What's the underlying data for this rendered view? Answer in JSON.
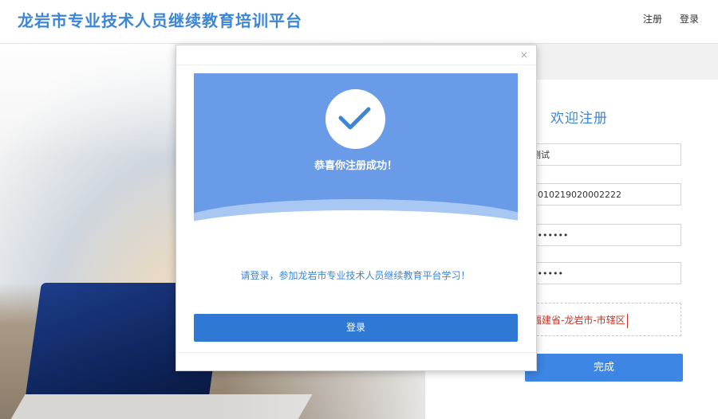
{
  "header": {
    "title": "龙岩市专业技术人员继续教育培训平台"
  },
  "nav": {
    "register": "注册",
    "login": "登录"
  },
  "register_form": {
    "title": "欢迎注册",
    "name_value": "测试",
    "id_value": "4010219020002222",
    "password_value": "•••••••",
    "confirm_value": "••••••",
    "region_value": "福建省-龙岩市-市辖区",
    "finish_label": "完成"
  },
  "modal": {
    "close": "×",
    "success": "恭喜你注册成功！",
    "tip": "请登录，参加龙岩市专业技术人员继续教育平台学习！",
    "login_label": "登录"
  }
}
